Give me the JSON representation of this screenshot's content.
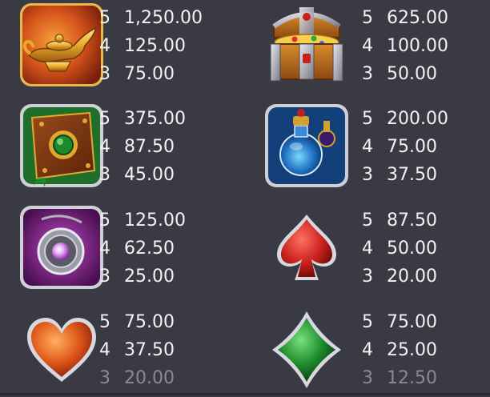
{
  "symbols": [
    {
      "name": "genie-lamp",
      "icon": "lamp-icon",
      "colors": {
        "bg": "#b7380f",
        "accent": "#f0b431"
      },
      "pays": [
        {
          "count": "5",
          "value": "1,250.00"
        },
        {
          "count": "4",
          "value": "125.00"
        },
        {
          "count": "3",
          "value": "75.00"
        }
      ]
    },
    {
      "name": "treasure-chest",
      "icon": "chest-icon",
      "colors": {
        "bg": "#c9781c",
        "accent": "#f6d04a"
      },
      "pays": [
        {
          "count": "5",
          "value": "625.00"
        },
        {
          "count": "4",
          "value": "100.00"
        },
        {
          "count": "3",
          "value": "50.00"
        }
      ]
    },
    {
      "name": "spell-book",
      "icon": "book-icon",
      "colors": {
        "bg": "#1f6f2a",
        "accent": "#7a3a16"
      },
      "pays": [
        {
          "count": "5",
          "value": "375.00"
        },
        {
          "count": "4",
          "value": "87.50"
        },
        {
          "count": "3",
          "value": "45.00"
        }
      ]
    },
    {
      "name": "potion",
      "icon": "potion-icon",
      "colors": {
        "bg": "#133f7a",
        "accent": "#3fb0e8"
      },
      "pays": [
        {
          "count": "5",
          "value": "200.00"
        },
        {
          "count": "4",
          "value": "75.00"
        },
        {
          "count": "3",
          "value": "37.50"
        }
      ]
    },
    {
      "name": "amulet",
      "icon": "amulet-icon",
      "colors": {
        "bg": "#7a1f7c",
        "accent": "#c9c9d6"
      },
      "pays": [
        {
          "count": "5",
          "value": "125.00"
        },
        {
          "count": "4",
          "value": "62.50"
        },
        {
          "count": "3",
          "value": "25.00"
        }
      ]
    },
    {
      "name": "spade",
      "icon": "spade-icon",
      "colors": {
        "bg": "#c8201e"
      },
      "pays": [
        {
          "count": "5",
          "value": "87.50"
        },
        {
          "count": "4",
          "value": "50.00"
        },
        {
          "count": "3",
          "value": "20.00"
        }
      ]
    },
    {
      "name": "heart",
      "icon": "heart-icon",
      "colors": {
        "bg": "#e0581a"
      },
      "pays": [
        {
          "count": "5",
          "value": "75.00"
        },
        {
          "count": "4",
          "value": "37.50"
        },
        {
          "count": "3",
          "value": "20.00"
        }
      ]
    },
    {
      "name": "diamond",
      "icon": "diamond-icon",
      "colors": {
        "bg": "#1c8a2c"
      },
      "pays": [
        {
          "count": "5",
          "value": "75.00"
        },
        {
          "count": "4",
          "value": "25.00"
        },
        {
          "count": "3",
          "value": "12.50"
        }
      ]
    }
  ]
}
